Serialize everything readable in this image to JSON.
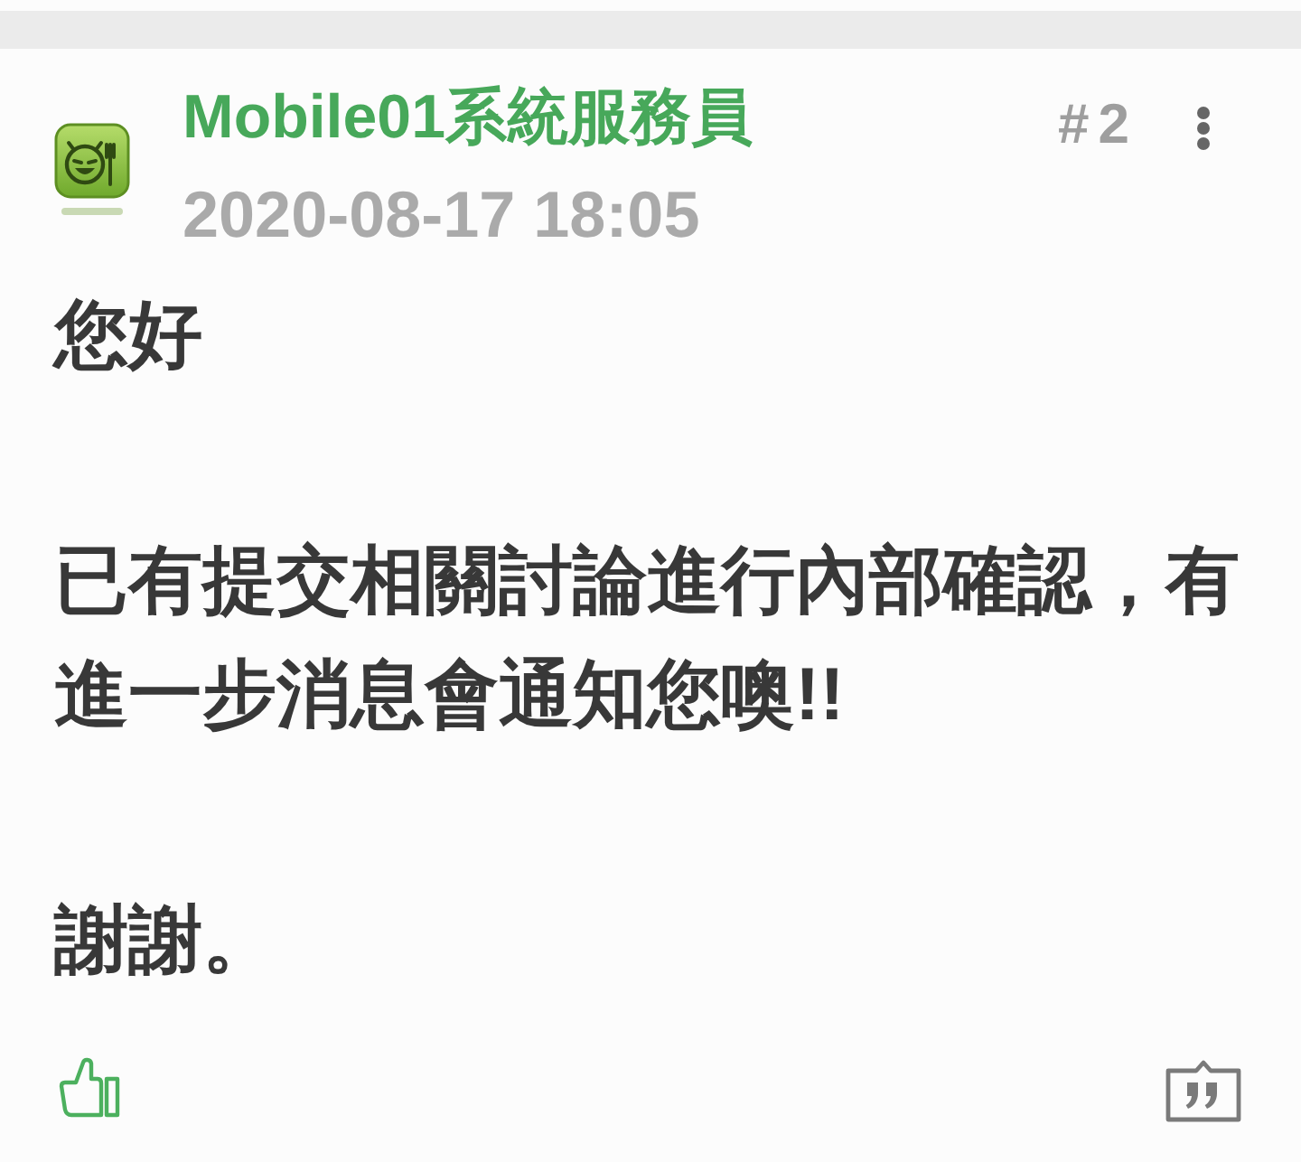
{
  "post": {
    "author": "Mobile01系統服務員",
    "date": "2020-08-17 18:05",
    "floor": "#2",
    "paragraphs": [
      "您好",
      "已有提交相關討論進行內部確認，有進一步消息會通知您噢!!",
      "謝謝。"
    ]
  }
}
